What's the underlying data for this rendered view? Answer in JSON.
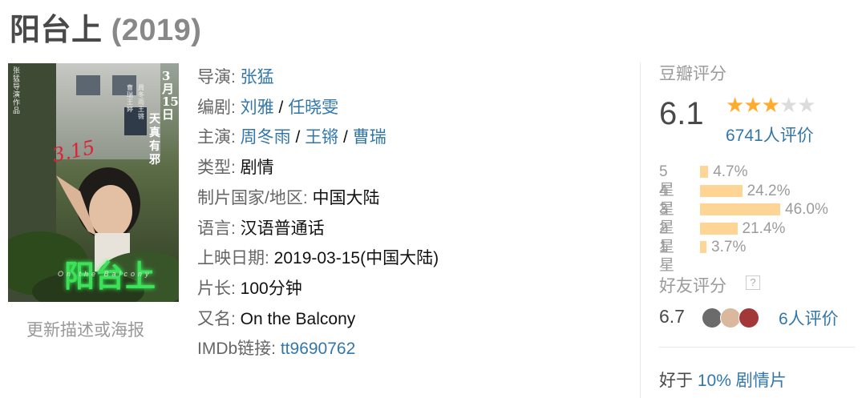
{
  "title": "阳台上",
  "year": "(2019)",
  "poster": {
    "date_text": "3月15日",
    "tagline": "天真有邪",
    "title_text": "阳台上",
    "scrawl": "3.15",
    "subtitle": "On the Balcony",
    "director_credit": "张猛导演作品",
    "cast_credit": "周冬雨 王锵",
    "cast_credit2": "曹瑞 王婷"
  },
  "update_link": "更新描述或海报",
  "info": {
    "director": {
      "label": "导演: ",
      "names": [
        "张猛"
      ]
    },
    "writer": {
      "label": "编剧: ",
      "names": [
        "刘雅",
        "任晓雯"
      ]
    },
    "cast": {
      "label": "主演: ",
      "names": [
        "周冬雨",
        "王锵",
        "曹瑞"
      ]
    },
    "genre": {
      "label": "类型: ",
      "value": "剧情"
    },
    "country": {
      "label": "制片国家/地区: ",
      "value": "中国大陆"
    },
    "language": {
      "label": "语言: ",
      "value": "汉语普通话"
    },
    "release": {
      "label": "上映日期: ",
      "value": "2019-03-15(中国大陆)"
    },
    "runtime": {
      "label": "片长: ",
      "value": "100分钟"
    },
    "aka": {
      "label": "又名: ",
      "value": "On the Balcony"
    },
    "imdb": {
      "label": "IMDb链接: ",
      "value": "tt9690762"
    },
    "separator": " / "
  },
  "rating": {
    "title": "豆瓣评分",
    "score": "6.1",
    "stars_filled": 3,
    "stars_total": 5,
    "votes": "6741人评价",
    "distribution": [
      {
        "label": "5星",
        "pct": "4.7%",
        "value": 4.7
      },
      {
        "label": "4星",
        "pct": "24.2%",
        "value": 24.2
      },
      {
        "label": "3星",
        "pct": "46.0%",
        "value": 46.0
      },
      {
        "label": "2星",
        "pct": "21.4%",
        "value": 21.4
      },
      {
        "label": "1星",
        "pct": "3.7%",
        "value": 3.7
      }
    ]
  },
  "friends": {
    "title": "好友评分",
    "help": "?",
    "score": "6.7",
    "votes": "6人评价",
    "avatar_colors": [
      "#6b6b6b",
      "#d9b89e",
      "#a33838"
    ]
  },
  "better_than": {
    "prefix": "好于 ",
    "link": "10% 剧情片"
  },
  "colors": {
    "link": "#3377aa",
    "star": "#ffac2d",
    "bar": "#ffd596"
  }
}
